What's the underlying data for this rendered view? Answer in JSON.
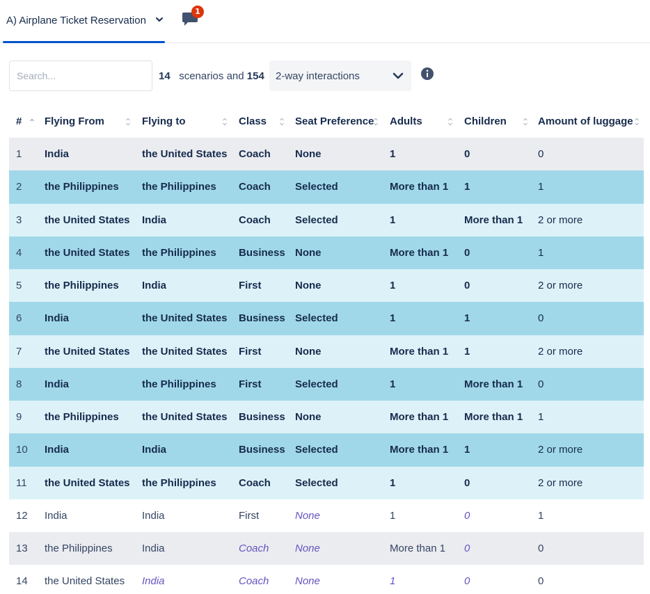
{
  "tab": {
    "label": "A) Airplane Ticket Reservation"
  },
  "comments": {
    "count": "1"
  },
  "toolbar": {
    "search_placeholder": "Search...",
    "scenarios_count": "14",
    "scenarios_text": "scenarios and",
    "interactions_count": "154",
    "interaction_mode": "2-way interactions"
  },
  "table": {
    "columns": [
      "#",
      "Flying From",
      "Flying to",
      "Class",
      "Seat Preference",
      "Adults",
      "Children",
      "Amount of luggage"
    ],
    "rows": [
      {
        "idx": "1",
        "cells": [
          "India",
          "the United States",
          "Coach",
          "None",
          "1",
          "0",
          "0"
        ]
      },
      {
        "idx": "2",
        "cells": [
          "the Philippines",
          "the Philippines",
          "Coach",
          "Selected",
          "More than 1",
          "1",
          "1"
        ]
      },
      {
        "idx": "3",
        "cells": [
          "the United States",
          "India",
          "Coach",
          "Selected",
          "1",
          "More than 1",
          "2 or more"
        ]
      },
      {
        "idx": "4",
        "cells": [
          "the United States",
          "the Philippines",
          "Business",
          "None",
          "More than 1",
          "0",
          "1"
        ]
      },
      {
        "idx": "5",
        "cells": [
          "the Philippines",
          "India",
          "First",
          "None",
          "1",
          "0",
          "2 or more"
        ]
      },
      {
        "idx": "6",
        "cells": [
          "India",
          "the United States",
          "Business",
          "Selected",
          "1",
          "1",
          "0"
        ]
      },
      {
        "idx": "7",
        "cells": [
          "the United States",
          "the United States",
          "First",
          "None",
          "More than 1",
          "1",
          "2 or more"
        ]
      },
      {
        "idx": "8",
        "cells": [
          "India",
          "the Philippines",
          "First",
          "Selected",
          "1",
          "More than 1",
          "0"
        ]
      },
      {
        "idx": "9",
        "cells": [
          "the Philippines",
          "the United States",
          "Business",
          "None",
          "More than 1",
          "More than 1",
          "1"
        ]
      },
      {
        "idx": "10",
        "cells": [
          "India",
          "India",
          "Business",
          "Selected",
          "More than 1",
          "1",
          "2 or more"
        ]
      },
      {
        "idx": "11",
        "cells": [
          "the United States",
          "the Philippines",
          "Coach",
          "Selected",
          "1",
          "0",
          "2 or more"
        ]
      },
      {
        "idx": "12",
        "cells": [
          "India",
          "India",
          "First",
          "None",
          "1",
          "0",
          "1"
        ]
      },
      {
        "idx": "13",
        "cells": [
          "the Philippines",
          "India",
          "Coach",
          "None",
          "More than 1",
          "0",
          "0"
        ]
      },
      {
        "idx": "14",
        "cells": [
          "the United States",
          "India",
          "Coach",
          "None",
          "1",
          "0",
          "0"
        ]
      }
    ]
  },
  "colors": {
    "accent": "#0052cc",
    "badge": "#de350b",
    "row_dark": "#a0d8e9",
    "row_light": "#dcf2f8",
    "row_grey": "#ebecf0",
    "wildcard_text": "#6554c0"
  }
}
